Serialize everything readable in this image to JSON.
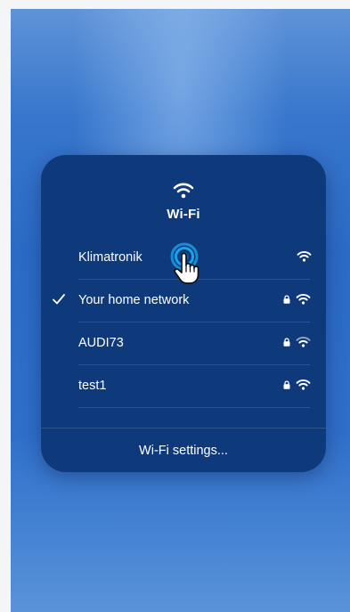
{
  "panel": {
    "title": "Wi-Fi",
    "header_icon": "wifi-icon",
    "settings_label": "Wi-Fi settings..."
  },
  "networks": [
    {
      "name": "Klimatronik",
      "selected": false,
      "locked": false,
      "icon": "wifi-icon"
    },
    {
      "name": "Your home network",
      "selected": true,
      "locked": true,
      "icon": "wifi-icon"
    },
    {
      "name": "AUDI73",
      "selected": false,
      "locked": true,
      "icon": "wifi-icon"
    },
    {
      "name": "test1",
      "selected": false,
      "locked": true,
      "icon": "wifi-icon"
    }
  ],
  "tap_indicator": {
    "icon": "hand-pointer-icon",
    "target": "Klimatronik"
  },
  "colors": {
    "panel_background": "#0e3a7c",
    "screen_background": "#2b6bc6",
    "tap_accent": "#1aa3e8",
    "text": "#ffffff"
  }
}
